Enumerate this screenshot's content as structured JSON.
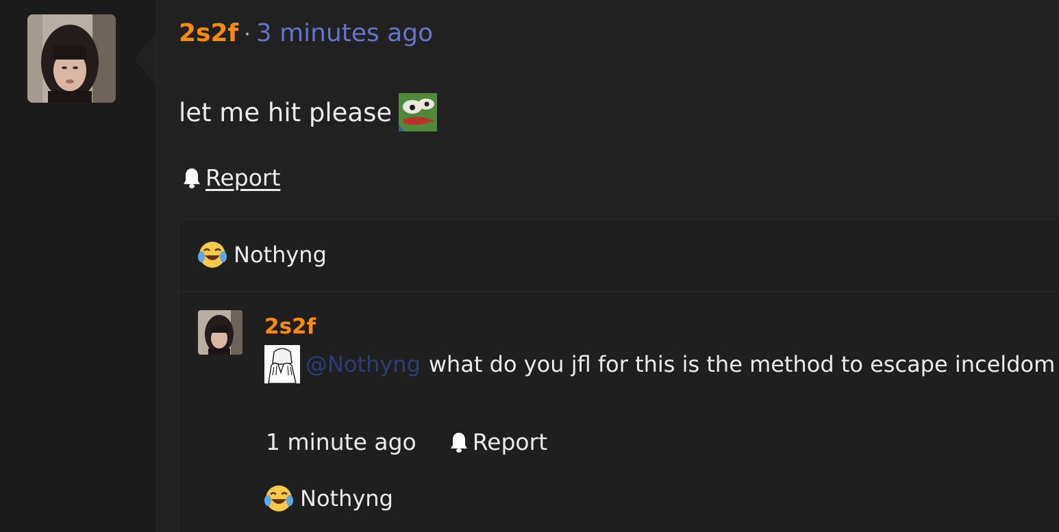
{
  "post": {
    "username": "2s2f",
    "separator": "·",
    "time": "3 minutes ago",
    "body": "let me hit please",
    "report_label": "Report"
  },
  "reaction_summary": {
    "user": "Nothyng"
  },
  "comment": {
    "username": "2s2f",
    "mention": "@Nothyng",
    "text": "what do you jfl for this is the method to escape inceldom",
    "time": "1 minute ago",
    "report_label": "Report",
    "reaction_user": "Nothyng"
  },
  "icons": {
    "bell": "bell-icon",
    "reaction": "laugh-cry-emoji-icon",
    "pepe": "pepe-emoji-icon",
    "facepalm": "facepalm-emoji-icon"
  },
  "colors": {
    "username": "#ff8c00",
    "time_link": "#6775c8",
    "mention": "#2d3e7a",
    "background": "#212121"
  }
}
